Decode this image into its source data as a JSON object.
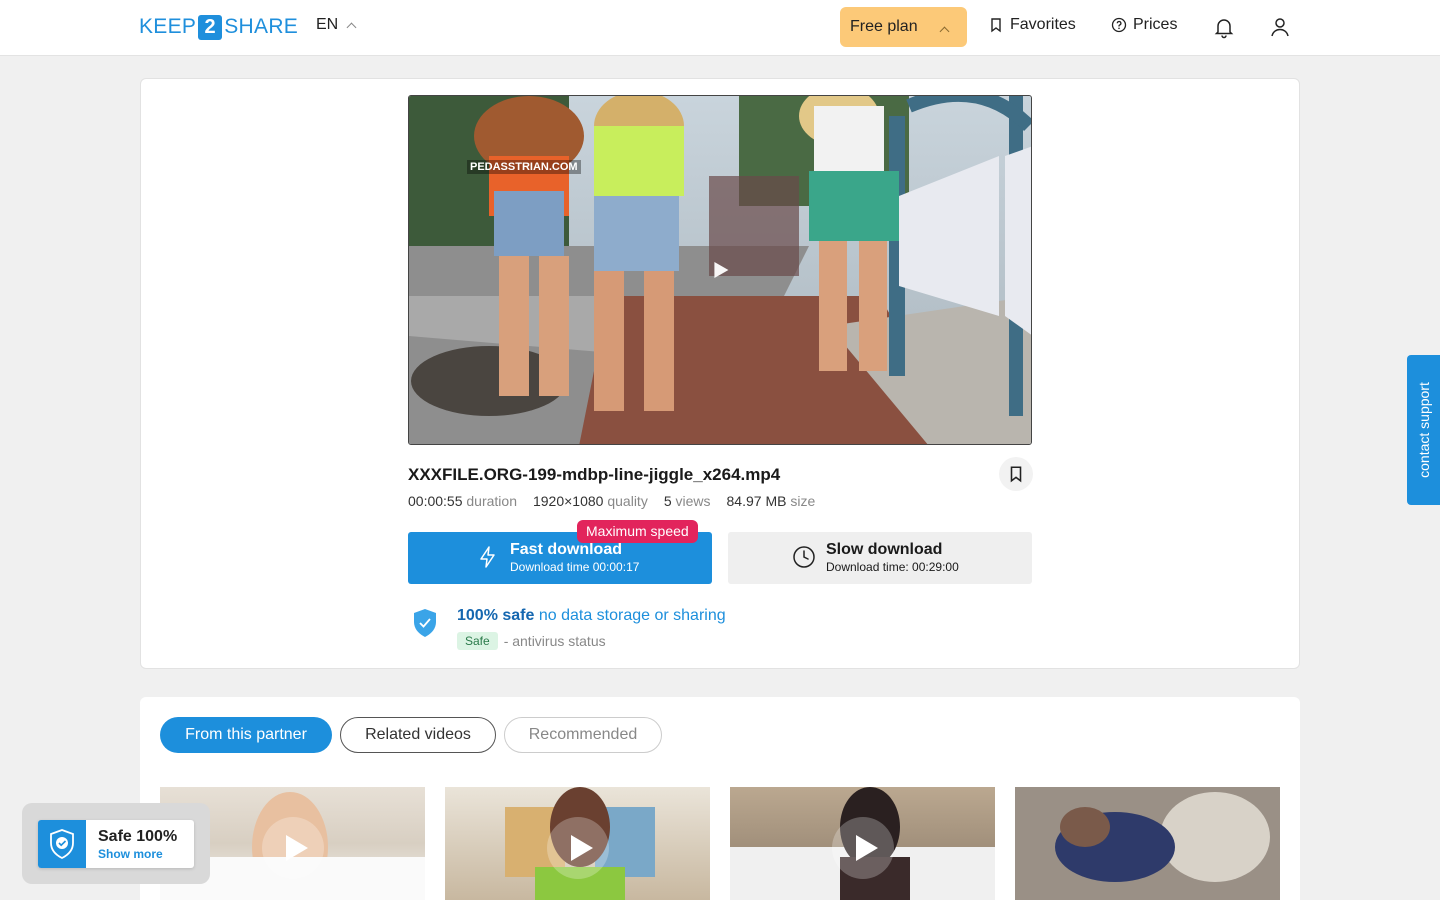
{
  "header": {
    "logo_left": "KEEP",
    "logo_num": "2",
    "logo_right": "SHARE",
    "language": "EN",
    "free_plan": "Free plan",
    "favorites": "Favorites",
    "prices": "Prices"
  },
  "file": {
    "name": "XXXFILE.ORG-199-mdbp-line-jiggle_x264.mp4",
    "duration_value": "00:00:55",
    "duration_label": "duration",
    "quality_value": "1920×1080",
    "quality_label": "quality",
    "views_value": "5",
    "views_label": "views",
    "size_value": "84.97 MB",
    "size_label": "size",
    "watermark": "PEDASSTRIAN.COM"
  },
  "download": {
    "fast_title": "Fast download",
    "fast_sub": "Download time 00:00:17",
    "badge": "Maximum speed",
    "slow_title": "Slow download",
    "slow_sub": "Download time: 00:29:00"
  },
  "safety": {
    "title_bold": "100% safe",
    "title_rest": "no data storage or sharing",
    "pill": "Safe",
    "status": "- antivirus status"
  },
  "tabs": [
    {
      "label": "From this partner"
    },
    {
      "label": "Related videos"
    },
    {
      "label": "Recommended"
    }
  ],
  "support": "contact support",
  "popup": {
    "title": "Safe 100%",
    "link": "Show more"
  },
  "colors": {
    "brand": "#1d8fdc",
    "plan": "#fcc978",
    "badge": "#e2245c"
  }
}
